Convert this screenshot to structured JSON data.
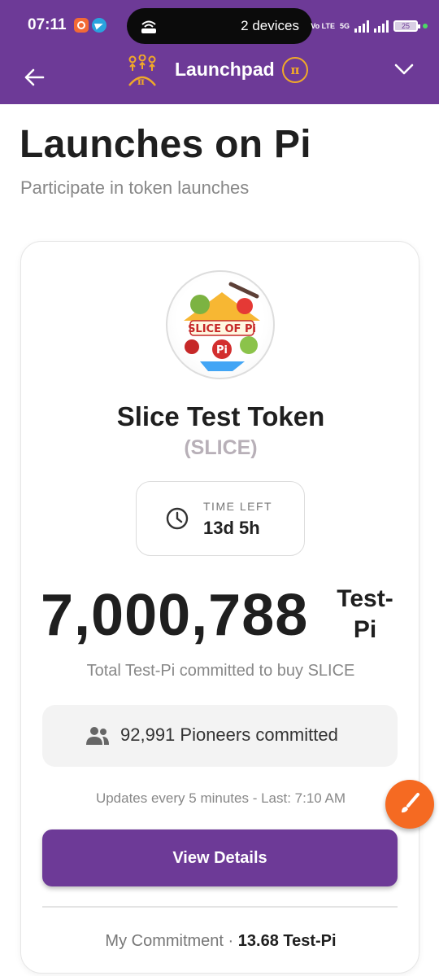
{
  "status_bar": {
    "time": "07:11",
    "pill_text": "2 devices",
    "network_label": "Vo LTE",
    "network_type": "5G",
    "battery": "25",
    "icons": [
      "camera-recorder-icon",
      "telegram-icon",
      "wifi-hotspot-icon",
      "signal-bars-icon",
      "battery-icon"
    ]
  },
  "header": {
    "title": "Launchpad",
    "coin_symbol": "π",
    "accent_color": "#6d3a97"
  },
  "page": {
    "title": "Launches on Pi",
    "subtitle": "Participate in token launches"
  },
  "token": {
    "logo_text": "SLICE OF Pi",
    "name": "Slice Test Token",
    "symbol": "(SLICE)",
    "time_left_label": "TIME LEFT",
    "time_left_value": "13d 5h",
    "committed_amount": "7,000,788",
    "unit_line1": "Test-",
    "unit_line2": "Pi",
    "committed_caption": "Total Test-Pi committed to buy SLICE",
    "pioneers": "92,991 Pioneers committed",
    "updates": "Updates every 5 minutes - Last: 7:10 AM",
    "button_label": "View Details",
    "my_commitment_label": "My Commitment ·",
    "my_commitment_value": "13.68 Test-Pi"
  },
  "fab_color": "#f56a22"
}
